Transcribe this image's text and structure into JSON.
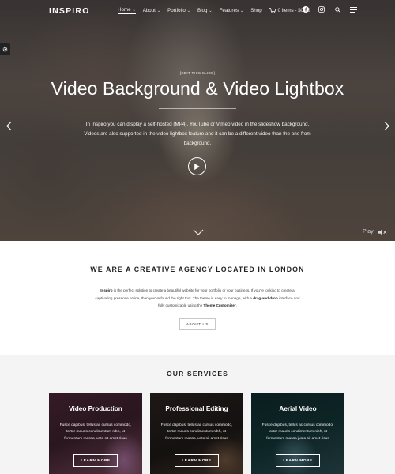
{
  "brand": {
    "logo": "INSPIRO"
  },
  "nav": {
    "items": [
      {
        "label": "Home",
        "caret": "⌄",
        "active": true
      },
      {
        "label": "About",
        "caret": "⌄"
      },
      {
        "label": "Portfolio",
        "caret": "⌄"
      },
      {
        "label": "Blog",
        "caret": "⌄"
      },
      {
        "label": "Features",
        "caret": "⌄"
      },
      {
        "label": "Shop",
        "caret": ""
      }
    ],
    "cart_label": "0 items - $0.00",
    "icons": [
      "cart-icon",
      "facebook-icon",
      "instagram-icon",
      "search-icon",
      "menu-icon"
    ]
  },
  "hero": {
    "edit_link": "[EDIT THIS SLIDE]",
    "title": "Video Background & Video Lightbox",
    "description": "In Inspiro you can display a self-hosted (MP4), YouTube or Vimeo video in the slideshow background. Videos are also supported in the video lightbox feature and it can be a different video than the one from background.",
    "play_label": "Play"
  },
  "about": {
    "heading": "WE ARE A CREATIVE AGENCY LOCATED IN LONDON",
    "text_parts": {
      "brand": "Inspiro",
      "p1": " is the perfect solution to create a beautiful website for your portfolio or your business. If you're looking to create a captivating presence online, then you've found the right tool. The theme is easy to manage, with a ",
      "dnd": "drag-and-drop",
      "p2": " interface and fully customizable using the ",
      "customizer": "Theme Customizer",
      "p3": "."
    },
    "button": "ABOUT US"
  },
  "services": {
    "heading": "OUR SERVICES",
    "cards": [
      {
        "title": "Video Production",
        "text": "Fusce dapibus, tellus ac cursus commodo, tortor mauris condimentum nibh, ut fermentum massa justo sit amet risus",
        "button": "LEARN MORE"
      },
      {
        "title": "Professional Editing",
        "text": "Fusce dapibus, tellus ac cursus commodo, tortor mauris condimentum nibh, ut fermentum massa justo sit amet risus",
        "button": "LEARN MORE"
      },
      {
        "title": "Aerial Video",
        "text": "Fusce dapibus, tellus ac cursus commodo, tortor mauris condimentum nibh, ut fermentum massa justo sit amet risus",
        "button": "LEARN MORE"
      }
    ]
  },
  "colors": {
    "hero_overlay": "#1f1c1c",
    "section_bg": "#f4f4f4",
    "text_dark": "#222222"
  }
}
